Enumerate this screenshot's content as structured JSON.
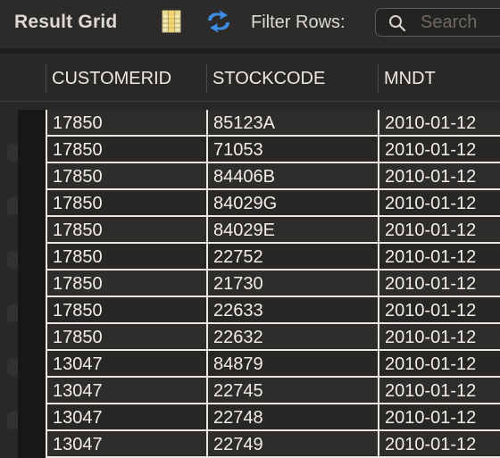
{
  "toolbar": {
    "title": "Result Grid",
    "filter_label": "Filter Rows:",
    "search_placeholder": "Search"
  },
  "columns": [
    "CUSTOMERID",
    "STOCKCODE",
    "MNDT"
  ],
  "rows": [
    [
      "17850",
      "85123A",
      "2010-01-12"
    ],
    [
      "17850",
      "71053",
      "2010-01-12"
    ],
    [
      "17850",
      "84406B",
      "2010-01-12"
    ],
    [
      "17850",
      "84029G",
      "2010-01-12"
    ],
    [
      "17850",
      "84029E",
      "2010-01-12"
    ],
    [
      "17850",
      "22752",
      "2010-01-12"
    ],
    [
      "17850",
      "21730",
      "2010-01-12"
    ],
    [
      "17850",
      "22633",
      "2010-01-12"
    ],
    [
      "17850",
      "22632",
      "2010-01-12"
    ],
    [
      "13047",
      "84879",
      "2010-01-12"
    ],
    [
      "13047",
      "22745",
      "2010-01-12"
    ],
    [
      "13047",
      "22748",
      "2010-01-12"
    ],
    [
      "13047",
      "22749",
      "2010-01-12"
    ]
  ],
  "icons": {
    "grid": "grid-icon",
    "refresh": "refresh-icon",
    "search": "search-icon"
  }
}
